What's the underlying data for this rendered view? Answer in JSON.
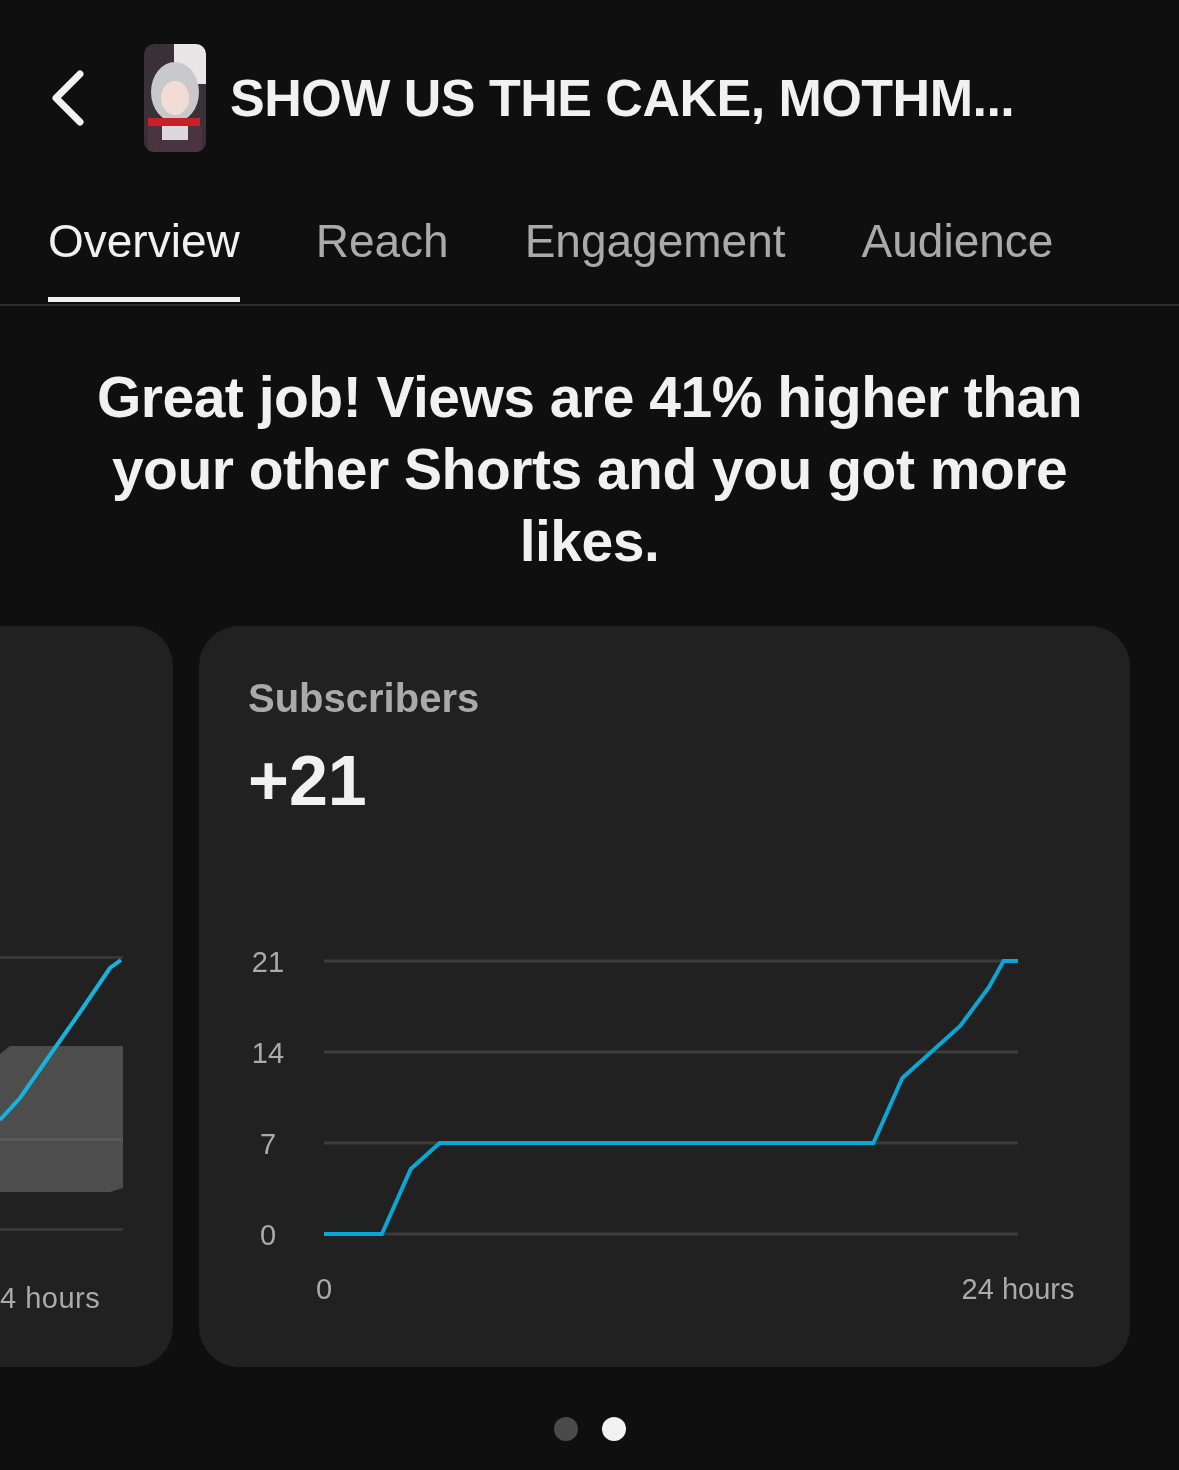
{
  "header": {
    "title": "SHOW US THE CAKE, MOTHM..."
  },
  "tabs": [
    {
      "label": "Overview",
      "selected": true
    },
    {
      "label": "Reach",
      "selected": false
    },
    {
      "label": "Engagement",
      "selected": false
    },
    {
      "label": "Audience",
      "selected": false
    }
  ],
  "headline": "Great job! Views are 41% higher than your other Shorts and you got more likes.",
  "cards": [
    {
      "kind": "partial",
      "x_label": "4 hours"
    },
    {
      "kind": "full",
      "value": "+21",
      "chart_data": {
        "type": "line",
        "x": [
          0,
          2,
          3,
          4,
          19,
          20,
          21,
          22,
          23,
          23.5,
          24
        ],
        "series": [
          {
            "name": "Subscribers",
            "color": "#0aa6d6",
            "values": [
              0,
              0,
              5,
              7,
              7,
              12,
              14,
              16,
              19,
              21,
              21
            ]
          }
        ],
        "xlim": [
          0,
          24
        ],
        "ylim": [
          0,
          21
        ],
        "yticks": [
          0,
          7,
          14,
          21
        ],
        "xticks": [
          {
            "value": 0,
            "label": "0"
          },
          {
            "value": 24,
            "label": "24 hours"
          }
        ]
      }
    }
  ],
  "pagination": [
    {
      "selected": false
    },
    {
      "selected": true
    }
  ]
}
